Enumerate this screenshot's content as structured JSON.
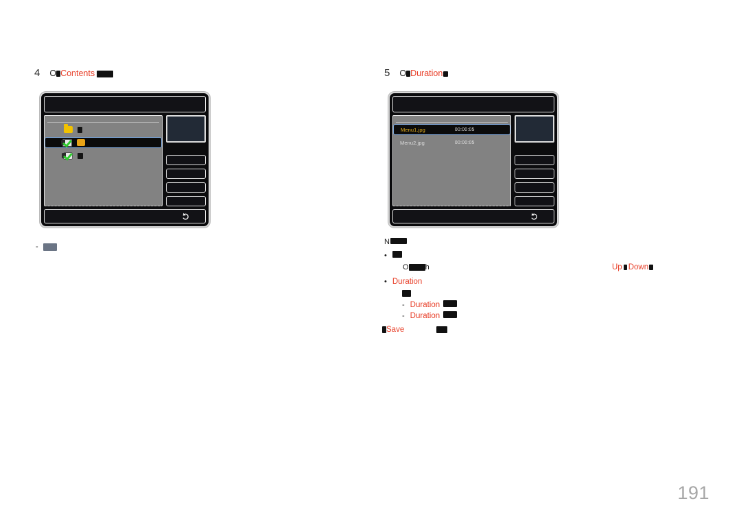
{
  "document": {
    "page_number": "191",
    "accent_color": "#e8402a",
    "redaction_color": "#111111"
  },
  "steps": [
    {
      "number": "4",
      "prefix": "O",
      "keyword": "Contents",
      "redacted_widths": [
        6,
        26
      ]
    },
    {
      "number": "5",
      "prefix": "O",
      "keyword": "Duration",
      "redacted_widths": [
        6,
        7
      ]
    }
  ],
  "screenshots": {
    "left": {
      "title_bar_label": "",
      "rows": [
        {
          "type": "folder",
          "icon": "folder-icon",
          "label": "",
          "label_kind": "redacted-dark",
          "label_width": 7,
          "selected": false
        },
        {
          "type": "file",
          "icon": "checkbox-checked-icon",
          "label": "",
          "label_kind": "redacted-amber",
          "label_width": 12,
          "selected": true
        },
        {
          "type": "file",
          "icon": "checkbox-checked-icon",
          "label": "",
          "label_kind": "redacted-dark",
          "label_width": 8,
          "selected": false
        }
      ],
      "side_buttons": [
        "",
        "",
        "",
        ""
      ],
      "preview_label": "",
      "back_icon": "back-arrow-icon"
    },
    "right": {
      "title_bar_label": "",
      "column_headers": [
        "",
        ""
      ],
      "rows": [
        {
          "name": "Menu1.jpg",
          "duration": "00:00:05",
          "selected": true
        },
        {
          "name": "Menu2.jpg",
          "duration": "00:00:05",
          "selected": false
        }
      ],
      "side_buttons": [
        "",
        "",
        "",
        ""
      ],
      "preview_label": "",
      "back_icon": "back-arrow-icon"
    }
  },
  "left_note": {
    "dash": "-",
    "redacted_width": 20
  },
  "notes": {
    "heading_prefix": "N",
    "heading_redacted_width": 26,
    "items": [
      {
        "bullet": "•",
        "lead_redacted_width": 14,
        "sub_prefix": "O",
        "sub_redacted_width": 26,
        "sub_suffix": "h",
        "right_text_a": "Up",
        "right_redacted_width": 5,
        "right_text_b": "Down",
        "right_trailing_redacted_width": 6
      },
      {
        "bullet": "•",
        "label": "Duration",
        "lead_redacted_width": 13,
        "sub_items": [
          {
            "dash": "-",
            "label": "Duration",
            "redacted_width": 20
          },
          {
            "dash": "-",
            "label": "Duration",
            "redacted_width": 20
          }
        ]
      }
    ],
    "footer": {
      "leading_redacted_width": 6,
      "label": "Save",
      "trailing_redacted_width": 16
    }
  }
}
